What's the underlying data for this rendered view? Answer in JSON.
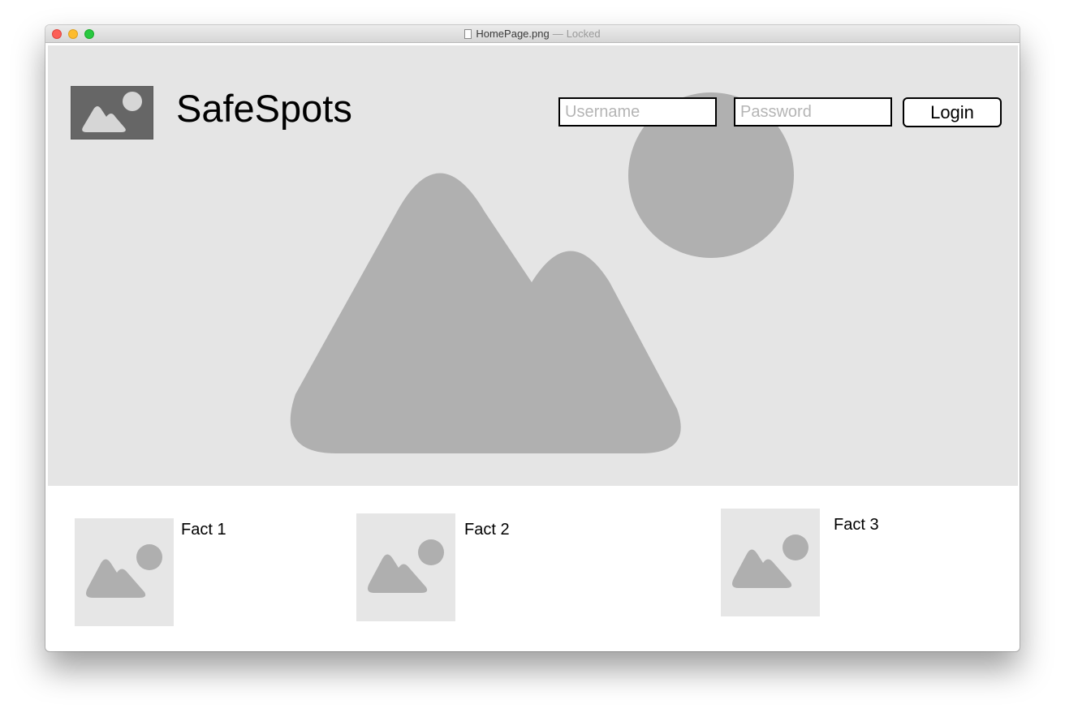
{
  "window": {
    "filename": "HomePage.png",
    "separator": "—",
    "status": "Locked"
  },
  "header": {
    "logo_icon": "image-placeholder-icon",
    "brand": "SafeSpots",
    "username_placeholder": "Username",
    "password_placeholder": "Password",
    "login_label": "Login"
  },
  "hero": {
    "icon": "image-placeholder-icon"
  },
  "facts": [
    {
      "label": "Fact 1",
      "icon": "image-placeholder-icon"
    },
    {
      "label": "Fact 2",
      "icon": "image-placeholder-icon"
    },
    {
      "label": "Fact 3",
      "icon": "image-placeholder-icon"
    }
  ],
  "colors": {
    "hero_background": "#e5e5e5",
    "placeholder_shape": "#b0b0b0",
    "logo_background": "#666666",
    "logo_shape": "#d6d6d6",
    "fact_background": "#e6e6e6",
    "fact_shape": "#afafaf"
  }
}
